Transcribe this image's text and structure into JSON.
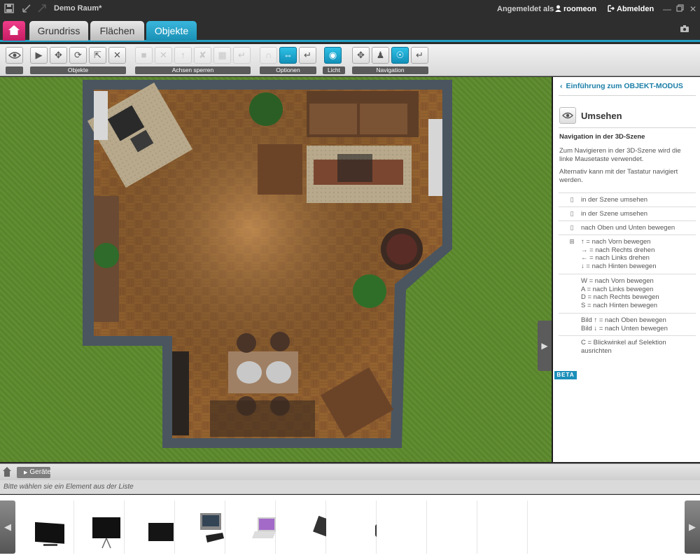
{
  "window": {
    "title": "Demo Raum*",
    "login_label": "Angemeldet als",
    "username": "roomeon",
    "logout_label": "Abmelden"
  },
  "tabs": [
    {
      "label": "Grundriss"
    },
    {
      "label": "Flächen"
    },
    {
      "label": "Objekte"
    }
  ],
  "toolbar": {
    "groups": [
      {
        "label": ""
      },
      {
        "label": "Objekte"
      },
      {
        "label": "Achsen sperren"
      },
      {
        "label": "Optionen"
      },
      {
        "label": "Licht"
      },
      {
        "label": "Navigation"
      }
    ]
  },
  "panel": {
    "intro_link": "Einführung zum OBJEKT-MODUS",
    "title": "Umsehen",
    "subtitle": "Navigation in der 3D-Szene",
    "para1": "Zum Navigieren in der 3D-Szene wird die linke Mausetaste verwendet.",
    "para2": "Alternativ kann mit der Tastatur navigiert werden.",
    "rows": [
      {
        "text": "in der Szene umsehen"
      },
      {
        "text": "in der Szene umsehen"
      },
      {
        "text": "nach Oben und Unten bewegen"
      },
      {
        "lines": [
          "↑ = nach Vorn bewegen",
          "→ = nach Rechts drehen",
          "← = nach Links drehen",
          "↓ = nach Hinten bewegen"
        ]
      },
      {
        "lines": [
          "W = nach Vorn bewegen",
          "A = nach Links bewegen",
          "D = nach Rechts bewegen",
          "S = nach Hinten bewegen"
        ]
      },
      {
        "lines": [
          "Bild ↑ = nach Oben bewegen",
          "Bild ↓ = nach Unten bewegen"
        ]
      },
      {
        "lines": [
          "C = Blickwinkel auf Selektion",
          "ausrichten"
        ]
      }
    ],
    "beta": "BETA"
  },
  "bottom": {
    "category": "Geräte",
    "hint": "Bitte wählen sie ein Element aus der Liste"
  },
  "icons": {
    "save": "save-icon",
    "home": "house-icon",
    "camera": "camera-icon"
  },
  "colors": {
    "accent": "#24a0c4",
    "home_button": "#e0327a",
    "grass": "#5c8a2e",
    "floor": "#8a5a2e"
  }
}
